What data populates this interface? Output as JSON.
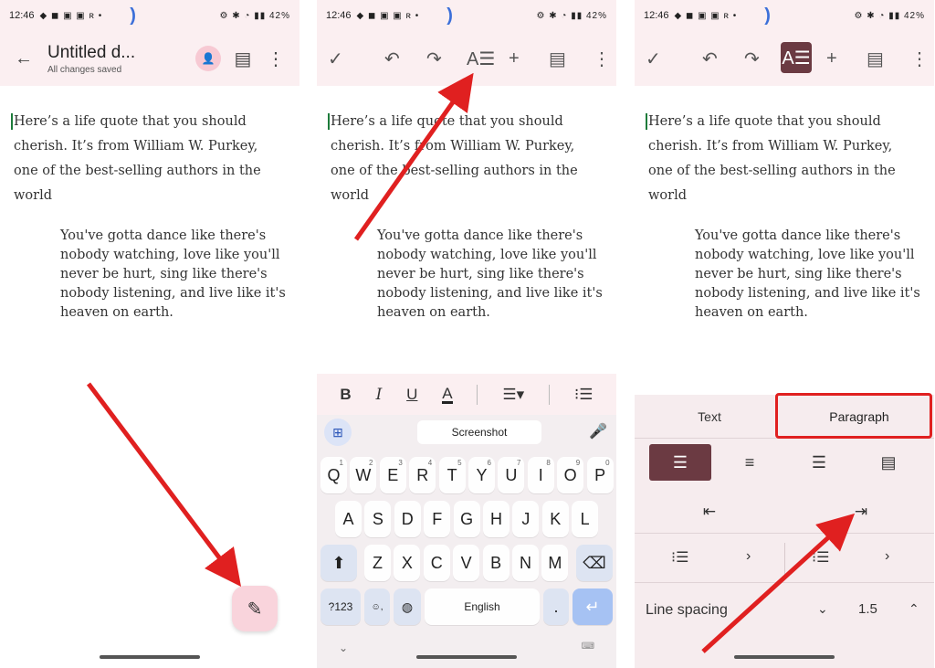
{
  "status": {
    "time": "12:46",
    "battery": "42%",
    "left_icons": "◆ ◼ ▣ ▣ ʀ •",
    "right_icons": "⚙ ✱ ◔ ▮▮"
  },
  "panel1": {
    "back_icon": "arrow-back-icon",
    "title": "Untitled d...",
    "subtitle": "All changes saved",
    "share_icon": "person-add-icon",
    "comment_icon": "comment-icon",
    "more_icon": "more-vert-icon",
    "fab_icon": "edit-pencil-icon"
  },
  "doc": {
    "intro": "Here’s a life quote that you should cherish. It’s from William W. Purkey, one of the best-selling authors in the world",
    "quote": "You've gotta dance like there's nobody watching, love like you'll never be hurt, sing like there's nobody listening, and live like it's heaven on earth."
  },
  "toolbar": {
    "check_icon": "check-icon",
    "undo_icon": "undo-icon",
    "redo_icon": "redo-icon",
    "format_icon": "text-format-icon",
    "insert_icon": "plus-icon",
    "comment_icon": "comment-icon",
    "more_icon": "more-vert-icon"
  },
  "format_bar": {
    "bold": "B",
    "italic": "I",
    "underline": "U",
    "text_color": "A",
    "align_icon": "align-menu-icon",
    "list_icon": "bulleted-list-icon"
  },
  "keyboard": {
    "clipboard": "Screenshot",
    "row1": [
      "Q",
      "W",
      "E",
      "R",
      "T",
      "Y",
      "U",
      "I",
      "O",
      "P"
    ],
    "row1_hints": [
      "1",
      "2",
      "3",
      "4",
      "5",
      "6",
      "7",
      "8",
      "9",
      "0"
    ],
    "row2": [
      "A",
      "S",
      "D",
      "F",
      "G",
      "H",
      "J",
      "K",
      "L"
    ],
    "row3": [
      "Z",
      "X",
      "C",
      "V",
      "B",
      "N",
      "M"
    ],
    "symbols": "?123",
    "emoji": "☺\n,",
    "globe": "🌐",
    "space": "English",
    "period": ".",
    "shift_icon": "shift-icon",
    "backspace_icon": "backspace-icon",
    "enter_icon": "enter-icon"
  },
  "paragraph_sheet": {
    "tabs": [
      "Text",
      "Paragraph"
    ],
    "active_tab": "Paragraph",
    "alignments": [
      "align-left-icon",
      "align-center-icon",
      "align-right-icon",
      "align-justify-icon"
    ],
    "active_alignment": "align-left-icon",
    "indent": [
      "decrease-indent-icon",
      "increase-indent-icon"
    ],
    "line_spacing_label": "Line spacing",
    "line_spacing_value": "1.5"
  },
  "annotation_color": "#e02020"
}
